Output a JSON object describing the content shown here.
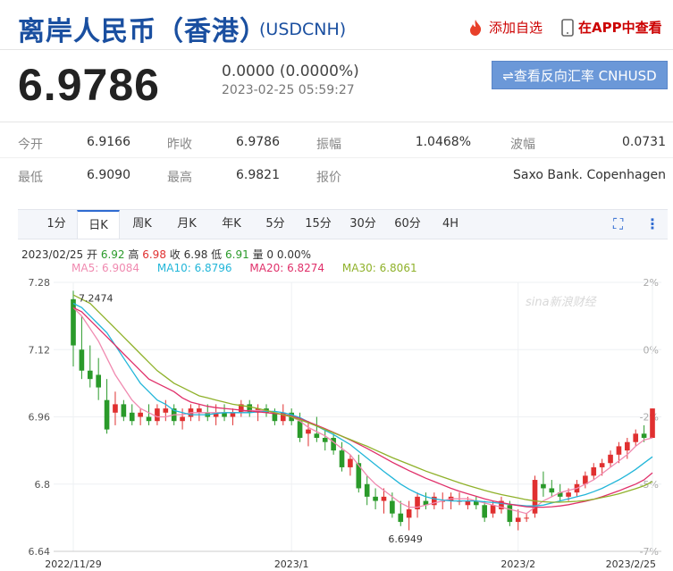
{
  "header": {
    "title": "离岸人民币（香港）",
    "code": "(USDCNH)",
    "add_fav": "添加自选",
    "in_app": "在APP中查看"
  },
  "quote": {
    "price": "6.9786",
    "change": "0.0000 (0.0000%)",
    "time": "2023-02-25 05:59:27",
    "reverse_button": "⇌查看反向汇率 CNHUSD"
  },
  "stats": {
    "row1": [
      {
        "label": "今开",
        "value": "6.9166"
      },
      {
        "label": "昨收",
        "value": "6.9786"
      },
      {
        "label": "振幅",
        "value": "1.0468%"
      },
      {
        "label": "波幅",
        "value": "0.0731"
      }
    ],
    "row2": [
      {
        "label": "最低",
        "value": "6.9090"
      },
      {
        "label": "最高",
        "value": "6.9821"
      },
      {
        "label": "报价",
        "value": ""
      },
      {
        "label": "",
        "value": "Saxo Bank. Copenhagen"
      }
    ]
  },
  "tabs": [
    "1分",
    "日K",
    "周K",
    "月K",
    "年K",
    "5分",
    "15分",
    "30分",
    "60分",
    "4H"
  ],
  "active_tab": "日K",
  "info_line": {
    "date": "2023/02/25",
    "open_label": "开",
    "open": "6.92",
    "high_label": "高",
    "high": "6.98",
    "close_label": "收",
    "close": "6.98",
    "low_label": "低",
    "low": "6.91",
    "vol_label": "量",
    "vol": "0",
    "pct": "0.00%"
  },
  "ma": [
    {
      "label": "MA5: 6.9084",
      "color": "#f08ab0"
    },
    {
      "label": "MA10: 6.8796",
      "color": "#22b6d9"
    },
    {
      "label": "MA20: 6.8274",
      "color": "#e0306a"
    },
    {
      "label": "MA30: 6.8061",
      "color": "#8fb12a"
    }
  ],
  "colors": {
    "up": "#e03030",
    "down": "#2a9a2a",
    "accent": "#2f6bd1"
  },
  "chart_data": {
    "type": "candlestick",
    "y_ticks": [
      "7.28",
      "7.12",
      "6.96",
      "6.8",
      "6.64"
    ],
    "y_ticks_right": [
      "2%",
      "0%",
      "-2%",
      "-5%",
      "-7%"
    ],
    "x_ticks": [
      "2022/11/29",
      "2023/1",
      "2023/2",
      "2023/2/25"
    ],
    "ylim": [
      6.64,
      7.28
    ],
    "max_label": "7.2474",
    "min_label": "6.6949",
    "watermark": "sina新浪财经",
    "candles": [
      [
        7.24,
        7.26,
        7.08,
        7.13
      ],
      [
        7.12,
        7.2,
        7.05,
        7.07
      ],
      [
        7.07,
        7.13,
        7.03,
        7.05
      ],
      [
        7.06,
        7.1,
        7.0,
        7.03
      ],
      [
        7.0,
        7.05,
        6.92,
        6.93
      ],
      [
        6.97,
        7.02,
        6.94,
        6.99
      ],
      [
        6.99,
        7.0,
        6.95,
        6.96
      ],
      [
        6.97,
        6.99,
        6.94,
        6.95
      ],
      [
        6.96,
        6.98,
        6.94,
        6.97
      ],
      [
        6.96,
        6.99,
        6.94,
        6.95
      ],
      [
        6.95,
        6.99,
        6.94,
        6.98
      ],
      [
        6.97,
        7.0,
        6.95,
        6.98
      ],
      [
        6.98,
        6.99,
        6.94,
        6.95
      ],
      [
        6.95,
        6.98,
        6.93,
        6.96
      ],
      [
        6.96,
        6.99,
        6.95,
        6.98
      ],
      [
        6.97,
        6.99,
        6.95,
        6.98
      ],
      [
        6.97,
        6.99,
        6.95,
        6.96
      ],
      [
        6.96,
        6.99,
        6.94,
        6.97
      ],
      [
        6.97,
        6.99,
        6.95,
        6.96
      ],
      [
        6.96,
        6.98,
        6.94,
        6.97
      ],
      [
        6.97,
        7.0,
        6.96,
        6.99
      ],
      [
        6.99,
        7.0,
        6.96,
        6.97
      ],
      [
        6.97,
        6.99,
        6.95,
        6.98
      ],
      [
        6.98,
        6.99,
        6.96,
        6.97
      ],
      [
        6.97,
        6.98,
        6.94,
        6.95
      ],
      [
        6.95,
        6.99,
        6.94,
        6.97
      ],
      [
        6.97,
        6.98,
        6.94,
        6.95
      ],
      [
        6.95,
        6.97,
        6.9,
        6.91
      ],
      [
        6.92,
        6.95,
        6.89,
        6.93
      ],
      [
        6.92,
        6.96,
        6.9,
        6.91
      ],
      [
        6.91,
        6.93,
        6.88,
        6.9
      ],
      [
        6.91,
        6.92,
        6.87,
        6.88
      ],
      [
        6.88,
        6.9,
        6.83,
        6.84
      ],
      [
        6.84,
        6.87,
        6.82,
        6.86
      ],
      [
        6.85,
        6.87,
        6.78,
        6.79
      ],
      [
        6.8,
        6.82,
        6.75,
        6.77
      ],
      [
        6.77,
        6.79,
        6.74,
        6.76
      ],
      [
        6.76,
        6.79,
        6.73,
        6.77
      ],
      [
        6.76,
        6.78,
        6.72,
        6.73
      ],
      [
        6.73,
        6.76,
        6.7,
        6.71
      ],
      [
        6.72,
        6.76,
        6.69,
        6.74
      ],
      [
        6.74,
        6.78,
        6.72,
        6.77
      ],
      [
        6.76,
        6.78,
        6.74,
        6.75
      ],
      [
        6.75,
        6.78,
        6.74,
        6.77
      ],
      [
        6.76,
        6.78,
        6.74,
        6.76
      ],
      [
        6.76,
        6.78,
        6.74,
        6.77
      ],
      [
        6.76,
        6.78,
        6.75,
        6.76
      ],
      [
        6.75,
        6.77,
        6.74,
        6.76
      ],
      [
        6.76,
        6.77,
        6.74,
        6.75
      ],
      [
        6.75,
        6.76,
        6.71,
        6.72
      ],
      [
        6.73,
        6.76,
        6.72,
        6.75
      ],
      [
        6.74,
        6.77,
        6.73,
        6.76
      ],
      [
        6.75,
        6.76,
        6.7,
        6.71
      ],
      [
        6.71,
        6.74,
        6.69,
        6.72
      ],
      [
        6.72,
        6.73,
        6.71,
        6.72
      ],
      [
        6.73,
        6.82,
        6.72,
        6.81
      ],
      [
        6.8,
        6.83,
        6.77,
        6.79
      ],
      [
        6.79,
        6.81,
        6.77,
        6.78
      ],
      [
        6.78,
        6.8,
        6.76,
        6.77
      ],
      [
        6.77,
        6.79,
        6.76,
        6.78
      ],
      [
        6.78,
        6.81,
        6.77,
        6.8
      ],
      [
        6.8,
        6.83,
        6.79,
        6.82
      ],
      [
        6.82,
        6.85,
        6.81,
        6.84
      ],
      [
        6.84,
        6.86,
        6.82,
        6.85
      ],
      [
        6.85,
        6.88,
        6.84,
        6.87
      ],
      [
        6.87,
        6.9,
        6.85,
        6.89
      ],
      [
        6.88,
        6.91,
        6.86,
        6.9
      ],
      [
        6.9,
        6.93,
        6.89,
        6.92
      ],
      [
        6.92,
        6.94,
        6.9,
        6.91
      ],
      [
        6.91,
        6.98,
        6.91,
        6.98
      ]
    ],
    "ma5": [
      7.22,
      7.2,
      7.17,
      7.14,
      7.1,
      7.06,
      7.03,
      7.0,
      6.98,
      6.97,
      6.96,
      6.96,
      6.965,
      6.965,
      6.97,
      6.97,
      6.97,
      6.97,
      6.97,
      6.97,
      6.97,
      6.975,
      6.975,
      6.975,
      6.97,
      6.965,
      6.96,
      6.95,
      6.935,
      6.925,
      6.915,
      6.9,
      6.885,
      6.87,
      6.845,
      6.82,
      6.8,
      6.785,
      6.77,
      6.755,
      6.745,
      6.745,
      6.75,
      6.755,
      6.76,
      6.765,
      6.765,
      6.765,
      6.76,
      6.755,
      6.75,
      6.745,
      6.74,
      6.735,
      6.73,
      6.745,
      6.76,
      6.77,
      6.78,
      6.785,
      6.79,
      6.8,
      6.81,
      6.825,
      6.84,
      6.855,
      6.87,
      6.89,
      6.905,
      6.91
    ],
    "ma10": [
      7.23,
      7.22,
      7.2,
      7.18,
      7.16,
      7.13,
      7.1,
      7.07,
      7.04,
      7.02,
      7.0,
      6.99,
      6.975,
      6.97,
      6.965,
      6.965,
      6.965,
      6.968,
      6.97,
      6.97,
      6.97,
      6.97,
      6.972,
      6.973,
      6.973,
      6.97,
      6.965,
      6.958,
      6.948,
      6.938,
      6.928,
      6.918,
      6.906,
      6.894,
      6.878,
      6.862,
      6.846,
      6.83,
      6.815,
      6.8,
      6.788,
      6.778,
      6.77,
      6.765,
      6.762,
      6.76,
      6.76,
      6.76,
      6.76,
      6.758,
      6.756,
      6.754,
      6.752,
      6.75,
      6.748,
      6.748,
      6.75,
      6.755,
      6.76,
      6.765,
      6.77,
      6.775,
      6.782,
      6.79,
      6.8,
      6.81,
      6.822,
      6.835,
      6.85,
      6.865
    ],
    "ma20": [
      7.22,
      7.21,
      7.19,
      7.17,
      7.15,
      7.13,
      7.11,
      7.09,
      7.07,
      7.05,
      7.04,
      7.03,
      7.02,
      7.005,
      6.995,
      6.99,
      6.985,
      6.982,
      6.98,
      6.978,
      6.976,
      6.974,
      6.972,
      6.97,
      6.968,
      6.966,
      6.962,
      6.956,
      6.948,
      6.94,
      6.932,
      6.923,
      6.914,
      6.905,
      6.895,
      6.885,
      6.874,
      6.863,
      6.852,
      6.842,
      6.832,
      6.823,
      6.814,
      6.806,
      6.798,
      6.79,
      6.783,
      6.777,
      6.771,
      6.765,
      6.76,
      6.756,
      6.752,
      6.749,
      6.746,
      6.745,
      6.745,
      6.746,
      6.748,
      6.751,
      6.755,
      6.759,
      6.764,
      6.77,
      6.777,
      6.784,
      6.792,
      6.8,
      6.81,
      6.827
    ],
    "ma30": [
      7.25,
      7.24,
      7.23,
      7.21,
      7.19,
      7.17,
      7.15,
      7.13,
      7.11,
      7.09,
      7.07,
      7.055,
      7.04,
      7.03,
      7.02,
      7.01,
      7.005,
      7.0,
      6.995,
      6.99,
      6.987,
      6.984,
      6.98,
      6.975,
      6.97,
      6.965,
      6.96,
      6.953,
      6.946,
      6.938,
      6.93,
      6.922,
      6.914,
      6.906,
      6.898,
      6.89,
      6.881,
      6.872,
      6.863,
      6.855,
      6.847,
      6.839,
      6.831,
      6.824,
      6.817,
      6.81,
      6.803,
      6.797,
      6.791,
      6.785,
      6.78,
      6.775,
      6.771,
      6.767,
      6.763,
      6.76,
      6.758,
      6.757,
      6.757,
      6.758,
      6.759,
      6.761,
      6.764,
      6.768,
      6.772,
      6.777,
      6.783,
      6.789,
      6.796,
      6.806
    ]
  }
}
